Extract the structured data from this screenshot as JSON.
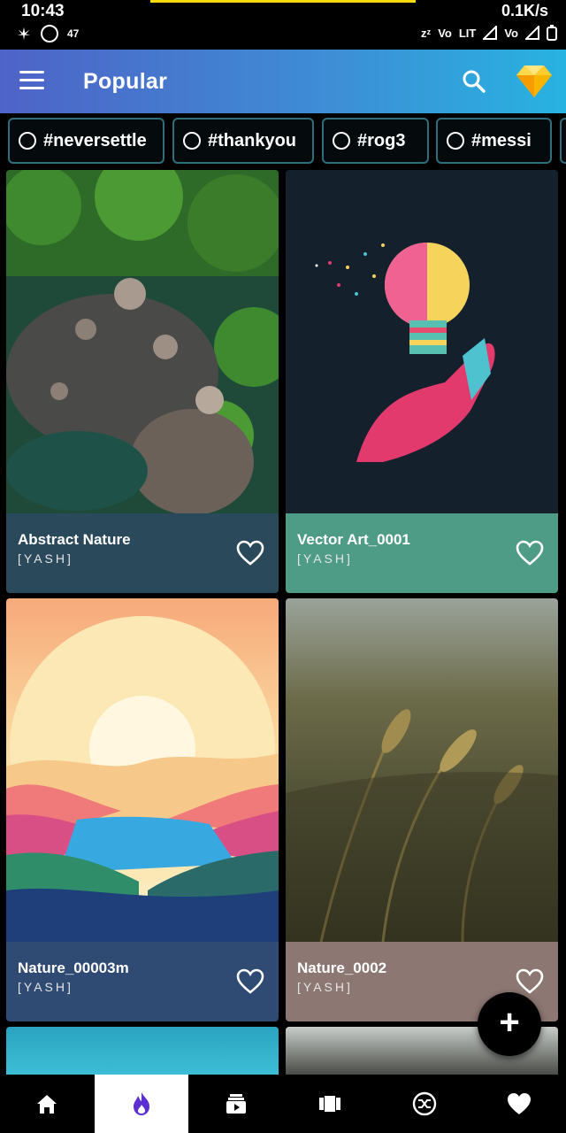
{
  "status_bar": {
    "time": "10:43",
    "whatsapp_count": "47",
    "network_speed": "0.1K/s",
    "network_labels": [
      "Vo",
      "LIT",
      "Vo"
    ],
    "icons": [
      "weed-leaf-icon",
      "whatsapp-icon",
      "snooze-icon",
      "signal-icon",
      "battery-icon"
    ]
  },
  "app_bar": {
    "title": "Popular",
    "icons": [
      "menu-icon",
      "search-icon",
      "diamond-icon"
    ],
    "accent_gradient": [
      "#4e63c7",
      "#27b3e1"
    ]
  },
  "chips": [
    {
      "label": "#neversettle"
    },
    {
      "label": "#thankyou"
    },
    {
      "label": "#rog3"
    },
    {
      "label": "#messi"
    }
  ],
  "wallpapers": [
    {
      "name": "Abstract Nature",
      "author": "[YASH]",
      "footer_color": "#2a4a5c"
    },
    {
      "name": "Vector Art_0001",
      "author": "[YASH]",
      "footer_color": "#4f9c86"
    },
    {
      "name": "Nature_00003m",
      "author": "[YASH]",
      "footer_color": "#2f4b74"
    },
    {
      "name": "Nature_0002",
      "author": "[YASH]",
      "footer_color": "#8d7772"
    }
  ],
  "fab": {
    "label": "+"
  },
  "bottom_nav": {
    "items": [
      "home-icon",
      "fire-icon",
      "collections-icon",
      "carousel-icon",
      "shuffle-icon",
      "favorite-icon"
    ],
    "active_index": 1,
    "active_color": "#5b2fd0"
  }
}
